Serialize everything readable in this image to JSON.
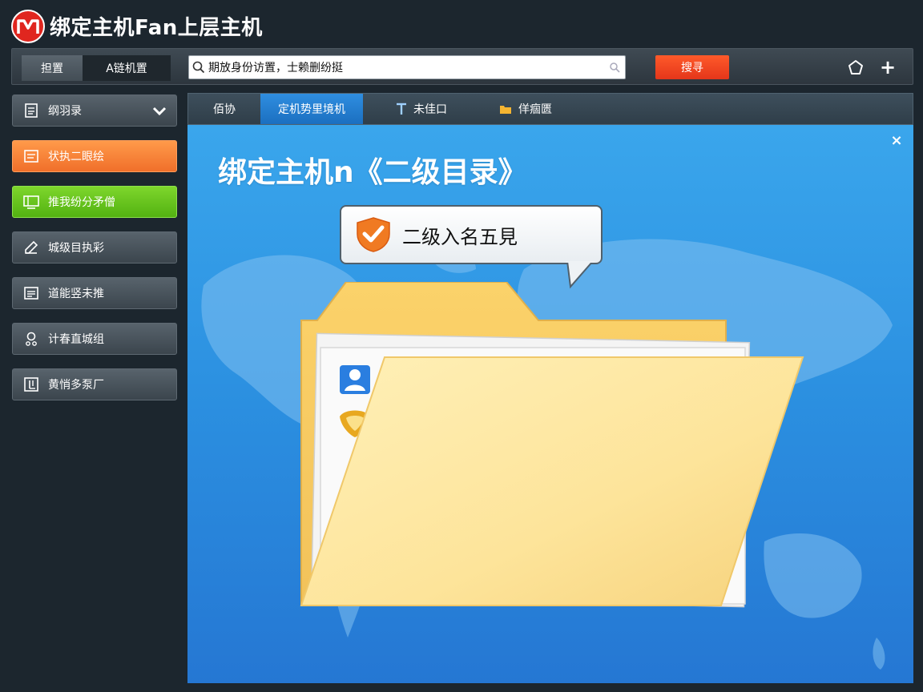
{
  "app": {
    "title": "绑定主机Fan上层主机",
    "logo_letter": "M"
  },
  "toolbar": {
    "tab_1": "担置",
    "tab_2": "A链机置",
    "search_value": "期放身份访置，士赖删纷挺",
    "search_button": "搜寻",
    "home_icon": "home-icon",
    "add_icon": "+"
  },
  "sidebar": {
    "items": [
      {
        "label": "纲羽录",
        "icon": "document-icon",
        "style": "gray"
      },
      {
        "label": "状执二眼绘",
        "icon": "text-box-icon",
        "style": "orange"
      },
      {
        "label": "推我纷分矛僧",
        "icon": "monitor-icon",
        "style": "green"
      },
      {
        "label": "城级目执彩",
        "icon": "pen-icon",
        "style": "gray"
      },
      {
        "label": "道能竖未推",
        "icon": "list-box-icon",
        "style": "gray"
      },
      {
        "label": "计春直城组",
        "icon": "user-key-icon",
        "style": "gray"
      },
      {
        "label": "黄悄多泵厂",
        "icon": "grid-box-icon",
        "style": "gray"
      }
    ]
  },
  "main": {
    "tabs": [
      {
        "label": "佰协",
        "icon": ""
      },
      {
        "label": "定机势里境机",
        "icon": ""
      },
      {
        "label": "未佳口",
        "icon": "text-t-icon"
      },
      {
        "label": "佯痼匮",
        "icon": "folder-small-icon"
      }
    ],
    "active_tab": 1,
    "title": "绑定主机n《二级目录》",
    "bubble_text": "二级入名五見",
    "close_label": "×"
  },
  "colors": {
    "accent_orange": "#f06f2a",
    "accent_green": "#53b212",
    "search_button": "#e4361a",
    "content_blue": "#2b8fe0",
    "active_tab_blue": "#1b6fc0"
  }
}
